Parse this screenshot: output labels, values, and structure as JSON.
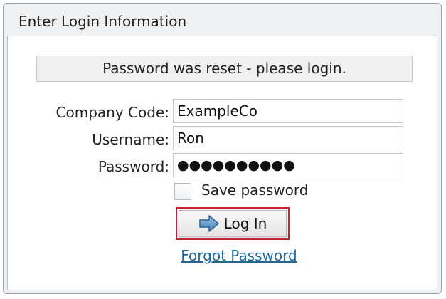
{
  "panel": {
    "title": "Enter Login Information"
  },
  "message": "Password was reset - please login.",
  "form": {
    "company_code": {
      "label": "Company Code:",
      "value": "ExampleCo"
    },
    "username": {
      "label": "Username:",
      "value": "Ron"
    },
    "password": {
      "label": "Password:",
      "value": "●●●●●●●●●●"
    },
    "save_password_label": "Save password",
    "save_password_checked": false
  },
  "login_button": {
    "label": "Log In",
    "icon": "arrow-right-icon",
    "highlight_color": "#c1272d"
  },
  "forgot_link": {
    "label": "Forgot Password",
    "color": "#1b6aa0"
  }
}
